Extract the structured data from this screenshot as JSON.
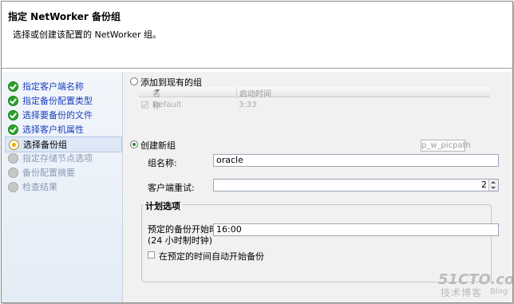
{
  "header": {
    "title": "指定 NetWorker 备份组",
    "subtitle": "选择或创建该配置的 NetWorker 组。"
  },
  "steps": [
    {
      "label": "指定客户端名称",
      "state": "done"
    },
    {
      "label": "指定备份配置类型",
      "state": "done"
    },
    {
      "label": "选择要备份的文件",
      "state": "done"
    },
    {
      "label": "选择客户机属性",
      "state": "done"
    },
    {
      "label": "选择备份组",
      "state": "current"
    },
    {
      "label": "指定存储节点选项",
      "state": "pending"
    },
    {
      "label": "备份配置摘要",
      "state": "pending"
    },
    {
      "label": "检查结果",
      "state": "pending"
    }
  ],
  "existing_group": {
    "radio_label": "添加到现有的组",
    "columns": [
      "名称",
      "启动时间"
    ],
    "rows": [
      {
        "name": "Default",
        "start": "3:33"
      }
    ]
  },
  "new_group": {
    "radio_label": "创建新组",
    "name_label": "组名称:",
    "name_value": "oracle",
    "retries_label": "客户端重试:",
    "retries_value": "2",
    "tooltip": "p_w_picpath"
  },
  "schedule": {
    "title": "计划选项",
    "start_label_line1": "预定的备份开始时间",
    "start_label_line2": "(24 小时制时钟)",
    "start_value": "16:00",
    "auto_label": "在预定的时间自动开始备份"
  },
  "watermark": {
    "site": "51CTO.com",
    "text": "技术博客",
    "blog": "Blog"
  }
}
